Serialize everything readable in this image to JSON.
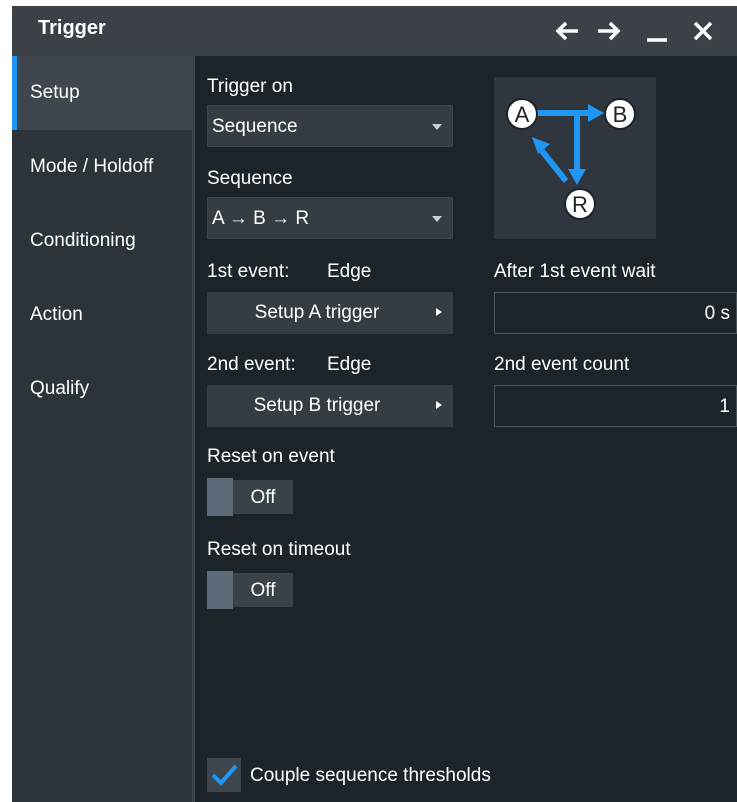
{
  "window": {
    "title": "Trigger"
  },
  "titlebar_icons": [
    "back-arrow-icon",
    "forward-arrow-icon",
    "minimize-icon",
    "close-icon"
  ],
  "sidebar": {
    "items": [
      {
        "label": "Setup",
        "active": true
      },
      {
        "label": "Mode / Holdoff",
        "active": false
      },
      {
        "label": "Conditioning",
        "active": false
      },
      {
        "label": "Action",
        "active": false
      },
      {
        "label": "Qualify",
        "active": false
      }
    ]
  },
  "trigger_on": {
    "label": "Trigger on",
    "value": "Sequence"
  },
  "sequence": {
    "label": "Sequence",
    "value": "A → B → R"
  },
  "diagram": {
    "node_a": "A",
    "node_b": "B",
    "node_r": "R"
  },
  "first_event": {
    "label": "1st event:",
    "type": "Edge",
    "button": "Setup A trigger"
  },
  "second_event": {
    "label": "2nd event:",
    "type": "Edge",
    "button": "Setup B trigger"
  },
  "wait": {
    "label": "After 1st event wait",
    "value": "0 s"
  },
  "count": {
    "label": "2nd event count",
    "value": "1"
  },
  "reset_event": {
    "label": "Reset on event",
    "state": "Off"
  },
  "reset_timeout": {
    "label": "Reset on timeout",
    "state": "Off"
  },
  "couple": {
    "label": "Couple sequence thresholds",
    "checked": true
  },
  "colors": {
    "accent": "#1f97f2",
    "background": "#1c2329",
    "sidebar": "#2c3339",
    "titlebar": "#3b4147"
  }
}
